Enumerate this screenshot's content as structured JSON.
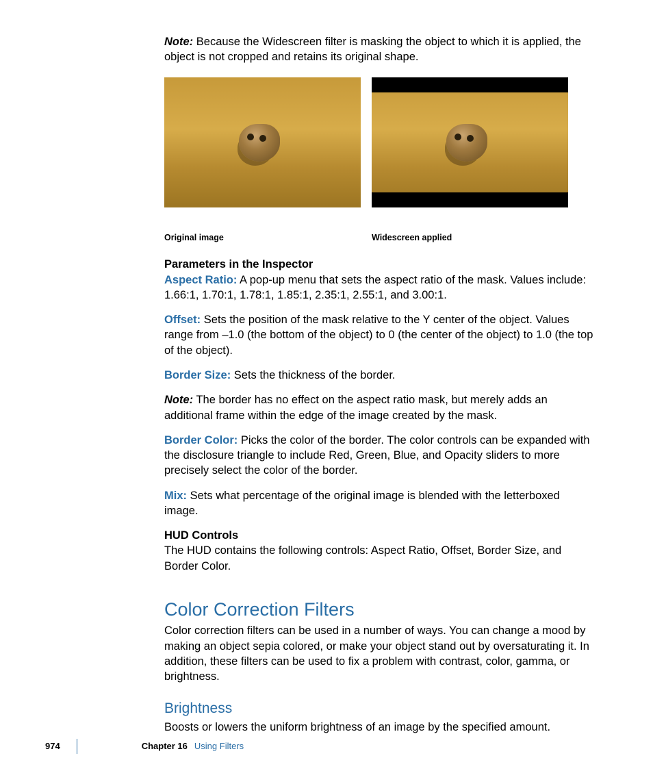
{
  "note_para": {
    "label": "Note:",
    "text": "Because the Widescreen filter is masking the object to which it is applied, the object is not cropped and retains its original shape."
  },
  "figures": [
    {
      "caption": "Original image",
      "letterboxed": false
    },
    {
      "caption": "Widescreen applied",
      "letterboxed": true
    }
  ],
  "params_heading": "Parameters in the Inspector",
  "params": [
    {
      "label": "Aspect Ratio:",
      "text": "A pop-up menu that sets the aspect ratio of the mask. Values include: 1.66:1, 1.70:1, 1.78:1, 1.85:1, 2.35:1, 2.55:1, and 3.00:1."
    },
    {
      "label": "Offset:",
      "text": "Sets the position of the mask relative to the Y center of the object. Values range from –1.0 (the bottom of the object) to 0 (the center of the object) to 1.0 (the top of the object)."
    },
    {
      "label": "Border Size:",
      "text": "Sets the thickness of the border."
    }
  ],
  "border_note": {
    "label": "Note:",
    "text": "The border has no effect on the aspect ratio mask, but merely adds an additional frame within the edge of the image created by the mask."
  },
  "params2": [
    {
      "label": "Border Color:",
      "text": "Picks the color of the border. The color controls can be expanded with the disclosure triangle to include Red, Green, Blue, and Opacity sliders to more precisely select the color of the border."
    },
    {
      "label": "Mix:",
      "text": "Sets what percentage of the original image is blended with the letterboxed image."
    }
  ],
  "hud": {
    "heading": "HUD Controls",
    "text": "The HUD contains the following controls: Aspect Ratio, Offset, Border Size, and Border Color."
  },
  "section": {
    "title": "Color Correction Filters",
    "intro": "Color correction filters can be used in a number of ways. You can change a mood by making an object sepia colored, or make your object stand out by oversaturating it. In addition, these filters can be used to fix a problem with contrast, color, gamma, or brightness."
  },
  "subsection": {
    "title": "Brightness",
    "text": "Boosts or lowers the uniform brightness of an image by the specified amount."
  },
  "footer": {
    "page": "974",
    "chapter_label": "Chapter 16",
    "chapter_title": "Using Filters"
  }
}
